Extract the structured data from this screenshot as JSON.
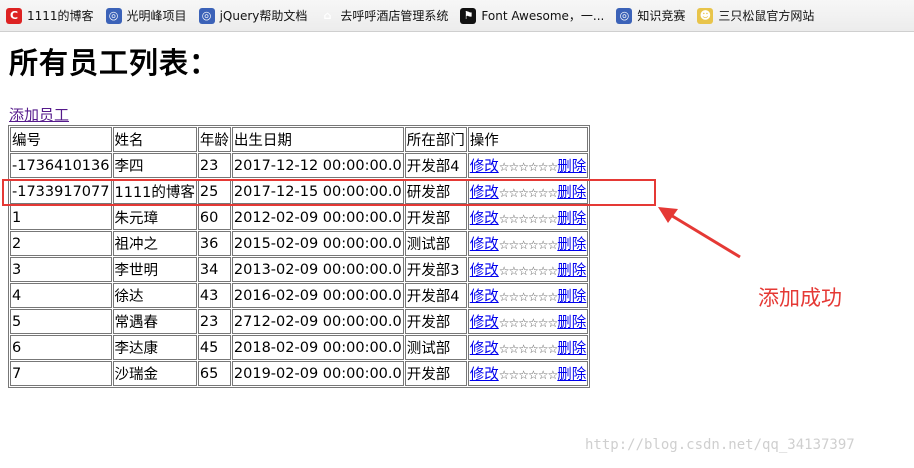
{
  "bookmarks": [
    {
      "label": "1111的博客",
      "icon": "csdn-icon"
    },
    {
      "label": "光明峰项目",
      "icon": "globe-icon"
    },
    {
      "label": "jQuery帮助文档",
      "icon": "globe-icon"
    },
    {
      "label": "去呼呼酒店管理系统",
      "icon": "home-icon"
    },
    {
      "label": "Font Awesome，一...",
      "icon": "flag-icon"
    },
    {
      "label": "知识竞赛",
      "icon": "globe-icon"
    },
    {
      "label": "三只松鼠官方网站",
      "icon": "squirrel-icon"
    }
  ],
  "page": {
    "title": "所有员工列表：",
    "add_link": "添加员工"
  },
  "table": {
    "headers": [
      "编号",
      "姓名",
      "年龄",
      "出生日期",
      "所在部门",
      "操作"
    ],
    "edit_label": "修改",
    "stars": "☆☆☆☆☆☆",
    "delete_label": "删除",
    "rows": [
      [
        "-1736410136",
        "李四",
        "23",
        "2017-12-12 00:00:00.0",
        "开发部4"
      ],
      [
        "-1733917077",
        "1111的博客",
        "25",
        "2017-12-15 00:00:00.0",
        "研发部"
      ],
      [
        "1",
        "朱元璋",
        "60",
        "2012-02-09 00:00:00.0",
        "开发部"
      ],
      [
        "2",
        "祖冲之",
        "36",
        "2015-02-09 00:00:00.0",
        "测试部"
      ],
      [
        "3",
        "李世明",
        "34",
        "2013-02-09 00:00:00.0",
        "开发部3"
      ],
      [
        "4",
        "徐达",
        "43",
        "2016-02-09 00:00:00.0",
        "开发部4"
      ],
      [
        "5",
        "常遇春",
        "23",
        "2712-02-09 00:00:00.0",
        "开发部"
      ],
      [
        "6",
        "李达康",
        "45",
        "2018-02-09 00:00:00.0",
        "测试部"
      ],
      [
        "7",
        "沙瑞金",
        "65",
        "2019-02-09 00:00:00.0",
        "开发部"
      ]
    ]
  },
  "annotation": {
    "text": "添加成功",
    "color": "#e53935"
  },
  "watermark": "http://blog.csdn.net/qq_34137397"
}
